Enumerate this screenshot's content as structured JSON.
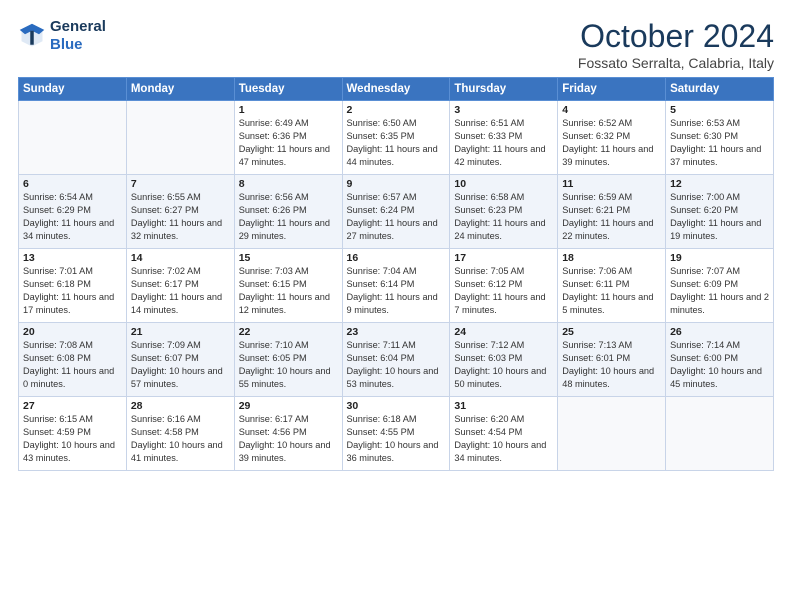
{
  "logo": {
    "line1": "General",
    "line2": "Blue"
  },
  "title": "October 2024",
  "location": "Fossato Serralta, Calabria, Italy",
  "days_of_week": [
    "Sunday",
    "Monday",
    "Tuesday",
    "Wednesday",
    "Thursday",
    "Friday",
    "Saturday"
  ],
  "weeks": [
    [
      {
        "day": "",
        "info": ""
      },
      {
        "day": "",
        "info": ""
      },
      {
        "day": "1",
        "info": "Sunrise: 6:49 AM\nSunset: 6:36 PM\nDaylight: 11 hours and 47 minutes."
      },
      {
        "day": "2",
        "info": "Sunrise: 6:50 AM\nSunset: 6:35 PM\nDaylight: 11 hours and 44 minutes."
      },
      {
        "day": "3",
        "info": "Sunrise: 6:51 AM\nSunset: 6:33 PM\nDaylight: 11 hours and 42 minutes."
      },
      {
        "day": "4",
        "info": "Sunrise: 6:52 AM\nSunset: 6:32 PM\nDaylight: 11 hours and 39 minutes."
      },
      {
        "day": "5",
        "info": "Sunrise: 6:53 AM\nSunset: 6:30 PM\nDaylight: 11 hours and 37 minutes."
      }
    ],
    [
      {
        "day": "6",
        "info": "Sunrise: 6:54 AM\nSunset: 6:29 PM\nDaylight: 11 hours and 34 minutes."
      },
      {
        "day": "7",
        "info": "Sunrise: 6:55 AM\nSunset: 6:27 PM\nDaylight: 11 hours and 32 minutes."
      },
      {
        "day": "8",
        "info": "Sunrise: 6:56 AM\nSunset: 6:26 PM\nDaylight: 11 hours and 29 minutes."
      },
      {
        "day": "9",
        "info": "Sunrise: 6:57 AM\nSunset: 6:24 PM\nDaylight: 11 hours and 27 minutes."
      },
      {
        "day": "10",
        "info": "Sunrise: 6:58 AM\nSunset: 6:23 PM\nDaylight: 11 hours and 24 minutes."
      },
      {
        "day": "11",
        "info": "Sunrise: 6:59 AM\nSunset: 6:21 PM\nDaylight: 11 hours and 22 minutes."
      },
      {
        "day": "12",
        "info": "Sunrise: 7:00 AM\nSunset: 6:20 PM\nDaylight: 11 hours and 19 minutes."
      }
    ],
    [
      {
        "day": "13",
        "info": "Sunrise: 7:01 AM\nSunset: 6:18 PM\nDaylight: 11 hours and 17 minutes."
      },
      {
        "day": "14",
        "info": "Sunrise: 7:02 AM\nSunset: 6:17 PM\nDaylight: 11 hours and 14 minutes."
      },
      {
        "day": "15",
        "info": "Sunrise: 7:03 AM\nSunset: 6:15 PM\nDaylight: 11 hours and 12 minutes."
      },
      {
        "day": "16",
        "info": "Sunrise: 7:04 AM\nSunset: 6:14 PM\nDaylight: 11 hours and 9 minutes."
      },
      {
        "day": "17",
        "info": "Sunrise: 7:05 AM\nSunset: 6:12 PM\nDaylight: 11 hours and 7 minutes."
      },
      {
        "day": "18",
        "info": "Sunrise: 7:06 AM\nSunset: 6:11 PM\nDaylight: 11 hours and 5 minutes."
      },
      {
        "day": "19",
        "info": "Sunrise: 7:07 AM\nSunset: 6:09 PM\nDaylight: 11 hours and 2 minutes."
      }
    ],
    [
      {
        "day": "20",
        "info": "Sunrise: 7:08 AM\nSunset: 6:08 PM\nDaylight: 11 hours and 0 minutes."
      },
      {
        "day": "21",
        "info": "Sunrise: 7:09 AM\nSunset: 6:07 PM\nDaylight: 10 hours and 57 minutes."
      },
      {
        "day": "22",
        "info": "Sunrise: 7:10 AM\nSunset: 6:05 PM\nDaylight: 10 hours and 55 minutes."
      },
      {
        "day": "23",
        "info": "Sunrise: 7:11 AM\nSunset: 6:04 PM\nDaylight: 10 hours and 53 minutes."
      },
      {
        "day": "24",
        "info": "Sunrise: 7:12 AM\nSunset: 6:03 PM\nDaylight: 10 hours and 50 minutes."
      },
      {
        "day": "25",
        "info": "Sunrise: 7:13 AM\nSunset: 6:01 PM\nDaylight: 10 hours and 48 minutes."
      },
      {
        "day": "26",
        "info": "Sunrise: 7:14 AM\nSunset: 6:00 PM\nDaylight: 10 hours and 45 minutes."
      }
    ],
    [
      {
        "day": "27",
        "info": "Sunrise: 6:15 AM\nSunset: 4:59 PM\nDaylight: 10 hours and 43 minutes."
      },
      {
        "day": "28",
        "info": "Sunrise: 6:16 AM\nSunset: 4:58 PM\nDaylight: 10 hours and 41 minutes."
      },
      {
        "day": "29",
        "info": "Sunrise: 6:17 AM\nSunset: 4:56 PM\nDaylight: 10 hours and 39 minutes."
      },
      {
        "day": "30",
        "info": "Sunrise: 6:18 AM\nSunset: 4:55 PM\nDaylight: 10 hours and 36 minutes."
      },
      {
        "day": "31",
        "info": "Sunrise: 6:20 AM\nSunset: 4:54 PM\nDaylight: 10 hours and 34 minutes."
      },
      {
        "day": "",
        "info": ""
      },
      {
        "day": "",
        "info": ""
      }
    ]
  ]
}
